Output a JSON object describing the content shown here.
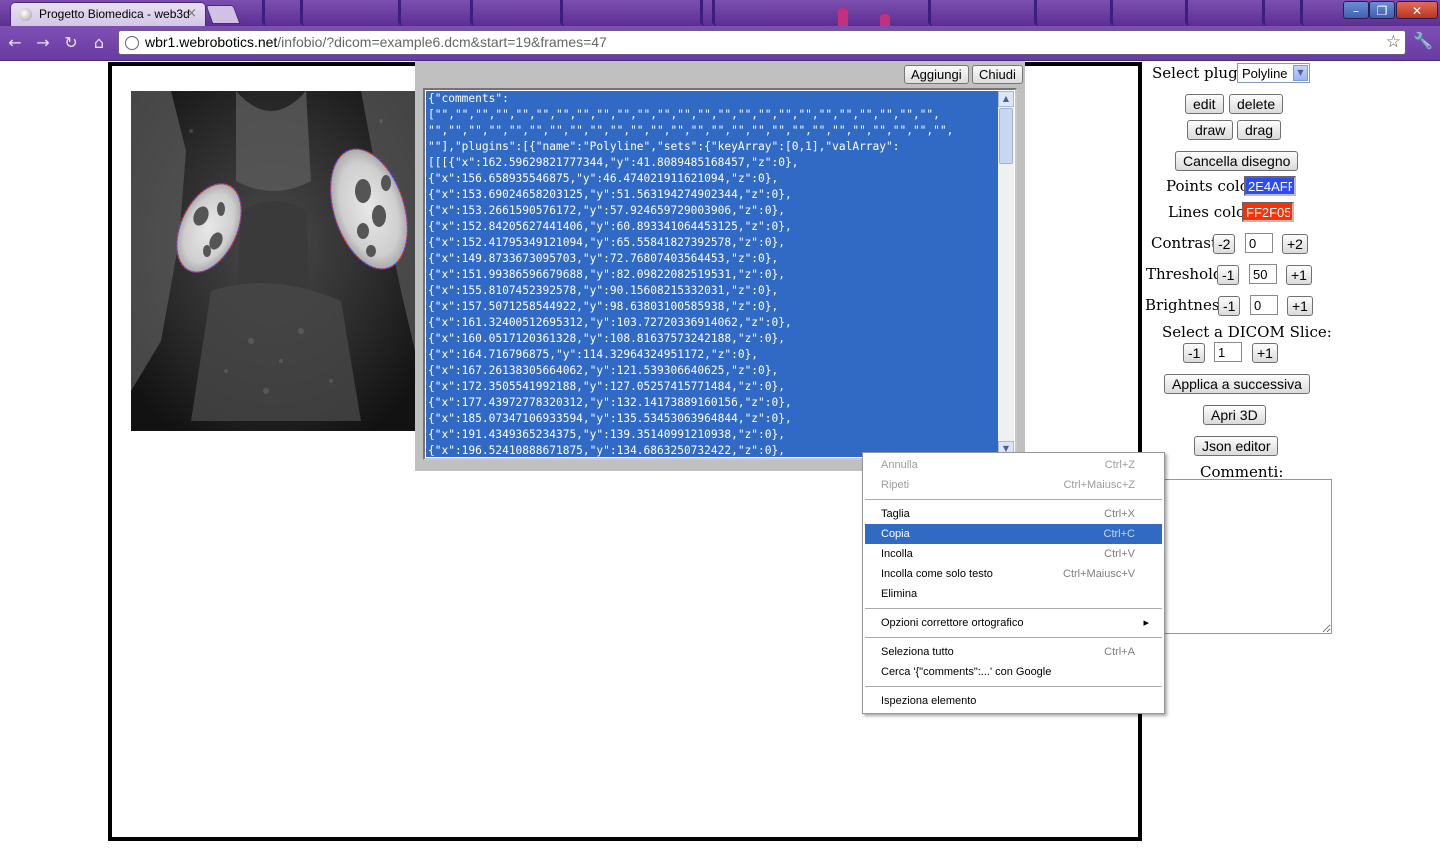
{
  "browser": {
    "tab_title": "Progetto Biomedica - web3d",
    "tab_close": "×",
    "url_domain": "wbr1.webrobotics.net",
    "url_path": "/infobio/?dicom=example6.dcm&start=19&frames=47",
    "window_controls": {
      "minimize": "–",
      "maximize": "❐",
      "close": "✕"
    },
    "nav_icons": [
      "back-icon",
      "forward-icon",
      "reload-icon",
      "home-icon"
    ]
  },
  "json_editor": {
    "add_label": "Aggiungi",
    "close_label": "Chiudi",
    "content": "{\"comments\":\n[\"\",\"\",\"\",\"\",\"\",\"\",\"\",\"\",\"\",\"\",\"\",\"\",\"\",\"\",\"\",\"\",\"\",\"\",\"\",\"\",\"\",\"\",\"\",\"\",\"\",\n\"\",\"\",\"\",\"\",\"\",\"\",\"\",\"\",\"\",\"\",\"\",\"\",\"\",\"\",\"\",\"\",\"\",\"\",\"\",\"\",\"\",\"\",\"\",\"\",\"\",\"\",\n\"\"],\"plugins\":[{\"name\":\"Polyline\",\"sets\":{\"keyArray\":[0,1],\"valArray\":\n[[[{\"x\":162.59629821777344,\"y\":41.8089485168457,\"z\":0},\n{\"x\":156.658935546875,\"y\":46.474021911621094,\"z\":0},\n{\"x\":153.69024658203125,\"y\":51.563194274902344,\"z\":0},\n{\"x\":153.2661590576172,\"y\":57.924659729003906,\"z\":0},\n{\"x\":152.84205627441406,\"y\":60.893341064453125,\"z\":0},\n{\"x\":152.41795349121094,\"y\":65.55841827392578,\"z\":0},\n{\"x\":149.8733673095703,\"y\":72.76807403564453,\"z\":0},\n{\"x\":151.99386596679688,\"y\":82.09822082519531,\"z\":0},\n{\"x\":155.8107452392578,\"y\":90.15608215332031,\"z\":0},\n{\"x\":157.5071258544922,\"y\":98.63803100585938,\"z\":0},\n{\"x\":161.32400512695312,\"y\":103.72720336914062,\"z\":0},\n{\"x\":160.0517120361328,\"y\":108.81637573242188,\"z\":0},\n{\"x\":164.716796875,\"y\":114.32964324951172,\"z\":0},\n{\"x\":167.26138305664062,\"y\":121.539306640625,\"z\":0},\n{\"x\":172.3505541992188,\"y\":127.05257415771484,\"z\":0},\n{\"x\":177.43972778320312,\"y\":132.14173889160156,\"z\":0},\n{\"x\":185.07347106933594,\"y\":135.53453063964844,\"z\":0},\n{\"x\":191.4349365234375,\"y\":139.35140991210938,\"z\":0},\n{\"x\":196.52410888671875,\"y\":134.6863250732422,\"z\":0},"
  },
  "controls": {
    "select_plugin_label": "Select plugin:",
    "plugin_value": "Polyline",
    "edit": "edit",
    "delete": "delete",
    "draw": "draw",
    "drag": "drag",
    "cancel_drawing": "Cancella disegno",
    "points_color_label": "Points color:",
    "points_color_value": "2E4AFF",
    "points_color": "#2E4AFF",
    "lines_color_label": "Lines color:",
    "lines_color_value": "FF2F05",
    "lines_color": "#FF2F05",
    "contrast_label": "Contrast:",
    "contrast_minus": "-2",
    "contrast_value": "0",
    "contrast_plus": "+2",
    "threshold_label": "Threshold:",
    "threshold_minus": "-1",
    "threshold_value": "50",
    "threshold_plus": "+1",
    "brightness_label": "Brightness:",
    "brightness_minus": "-1",
    "brightness_value": "0",
    "brightness_plus": "+1",
    "slice_label": "Select a DICOM Slice:",
    "slice_minus": "-1",
    "slice_value": "1",
    "slice_plus": "+1",
    "apply_next": "Applica a successiva",
    "open_3d": "Apri 3D",
    "json_editor": "Json editor",
    "comments_label": "Commenti:"
  },
  "context_menu": {
    "items": [
      {
        "label": "Annulla",
        "shortcut": "Ctrl+Z"
      },
      {
        "label": "Ripeti",
        "shortcut": "Ctrl+Maiusc+Z"
      },
      {
        "label": "Taglia",
        "shortcut": "Ctrl+X"
      },
      {
        "label": "Copia",
        "shortcut": "Ctrl+C"
      },
      {
        "label": "Incolla",
        "shortcut": "Ctrl+V"
      },
      {
        "label": "Incolla come solo testo",
        "shortcut": "Ctrl+Maiusc+V"
      },
      {
        "label": "Elimina",
        "shortcut": ""
      },
      {
        "label": "Opzioni correttore ortografico",
        "shortcut": "▸"
      },
      {
        "label": "Seleziona tutto",
        "shortcut": "Ctrl+A"
      },
      {
        "label": "Cerca '{\"comments\":...' con Google",
        "shortcut": ""
      },
      {
        "label": "Ispeziona elemento",
        "shortcut": ""
      }
    ]
  },
  "colors": {
    "json_highlight": "#316AC5",
    "menu_highlight": "#316AC5",
    "browser_theme": "#6A3CA3"
  }
}
